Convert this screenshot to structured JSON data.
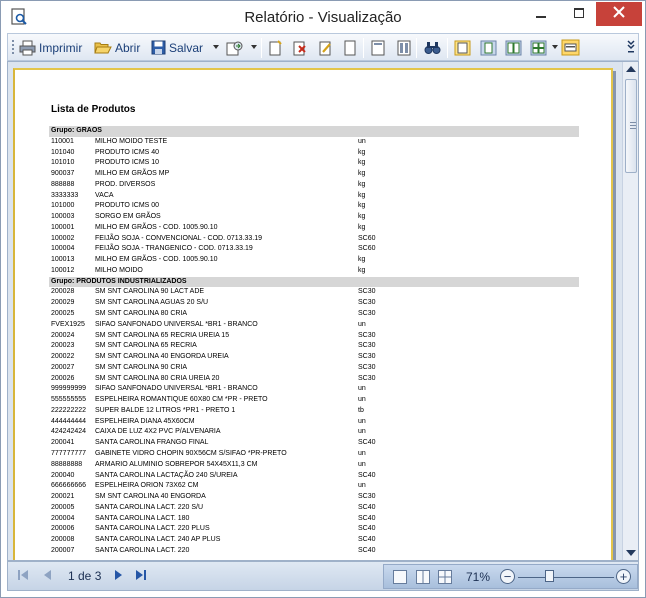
{
  "window": {
    "title": "Relatório - Visualização",
    "min_glyph": "—",
    "max_glyph": "☐",
    "close_glyph": "✕"
  },
  "toolbar": {
    "print_label": "Imprimir",
    "open_label": "Abrir",
    "save_label": "Salvar"
  },
  "report": {
    "title": "Lista de Produtos",
    "groups": [
      {
        "name": "Grupo: GRAOS",
        "items": [
          [
            "110001",
            "MILHO MOIDO TESTE",
            "un"
          ],
          [
            "101040",
            "PRODUTO ICMS 40",
            "kg"
          ],
          [
            "101010",
            "PRODUTO ICMS 10",
            "kg"
          ],
          [
            "900037",
            "MILHO EM GRÃOS MP",
            "kg"
          ],
          [
            "888888",
            "PROD. DIVERSOS",
            "kg"
          ],
          [
            "3333333",
            "VACA",
            "kg"
          ],
          [
            "101000",
            "PRODUTO ICMS 00",
            "kg"
          ],
          [
            "100003",
            "SORGO EM GRÃOS",
            "kg"
          ],
          [
            "100001",
            "MILHO EM GRÃOS - COD. 1005.90.10",
            "kg"
          ],
          [
            "100002",
            "FEIJÃO SOJA - CONVENCIONAL - COD. 0713.33.19",
            "SC60"
          ],
          [
            "100004",
            "FEIJÃO SOJA - TRANGENICO - COD. 0713.33.19",
            "SC60"
          ],
          [
            "100013",
            "MILHO EM GRÃOS - COD. 1005.90.10",
            "kg"
          ],
          [
            "100012",
            "MILHO MOIDO",
            "kg"
          ]
        ]
      },
      {
        "name": "Grupo: PRODUTOS INDUSTRIALIZADOS",
        "items": [
          [
            "200028",
            "SM SNT CAROLINA 90 LACT ADE",
            "SC30"
          ],
          [
            "200029",
            "SM SNT CAROLINA AGUAS 20 S/U",
            "SC30"
          ],
          [
            "200025",
            "SM SNT CAROLINA 80 CRIA",
            "SC30"
          ],
          [
            "FVEX1925",
            "SIFAO SANFONADO UNIVERSAL *BR1 - BRANCO",
            "un"
          ],
          [
            "200024",
            "SM SNT CAROLINA 65 RECRIA UREIA 15",
            "SC30"
          ],
          [
            "200023",
            "SM SNT CAROLINA 65 RECRIA",
            "SC30"
          ],
          [
            "200022",
            "SM SNT CAROLINA 40 ENGORDA UREIA",
            "SC30"
          ],
          [
            "200027",
            "SM SNT CAROLINA 90 CRIA",
            "SC30"
          ],
          [
            "200026",
            "SM SNT CAROLINA 80 CRIA UREIA 20",
            "SC30"
          ],
          [
            "999999999",
            "SIFAO SANFONADO UNIVERSAL *BR1 - BRANCO",
            "un"
          ],
          [
            "555555555",
            "ESPELHEIRA ROMANTIQUE 60X80 CM *PR - PRETO",
            "un"
          ],
          [
            "222222222",
            "SUPER BALDE 12 LITROS *PR1 - PRETO 1",
            "tb"
          ],
          [
            "444444444",
            "ESPELHEIRA DIANA 45X60CM",
            "un"
          ],
          [
            "424242424",
            "CAIXA DE LUZ 4X2 PVC P/ALVENARIA",
            "un"
          ],
          [
            "200041",
            "SANTA CAROLINA FRANGO FINAL",
            "SC40"
          ],
          [
            "777777777",
            "GABINETE VIDRO CHOPIN 90X56CM S/SIFAO *PR-PRETO",
            "un"
          ],
          [
            "88888888",
            "ARMARIO ALUMINIO SOBREPOR 54X45X11,3 CM",
            "un"
          ],
          [
            "200040",
            "SANTA CAROLINA LACTAÇÃO 240 S/UREIA",
            "SC40"
          ],
          [
            "666666666",
            "ESPELHEIRA ORION 73X62 CM",
            "un"
          ],
          [
            "200021",
            "SM SNT CAROLINA 40 ENGORDA",
            "SC30"
          ],
          [
            "200005",
            "SANTA CAROLINA LACT. 220 S/U",
            "SC40"
          ],
          [
            "200004",
            "SANTA CAROLINA LACT. 180",
            "SC40"
          ],
          [
            "200006",
            "SANTA CAROLINA LACT. 220 PLUS",
            "SC40"
          ],
          [
            "200008",
            "SANTA CAROLINA LACT. 240 AP PLUS",
            "SC40"
          ],
          [
            "200007",
            "SANTA CAROLINA LACT. 220",
            "SC40"
          ]
        ]
      }
    ]
  },
  "statusbar": {
    "pager_text": "1 de 3",
    "zoom_text": "71%",
    "zoom_minus": "−",
    "zoom_plus": "+",
    "zoom_level_percent": 71
  },
  "colors": {
    "accent": "#1b3f78",
    "close_button": "#c7423a",
    "page_border": "#e3c54a",
    "group_band": "#d6d6d6"
  }
}
